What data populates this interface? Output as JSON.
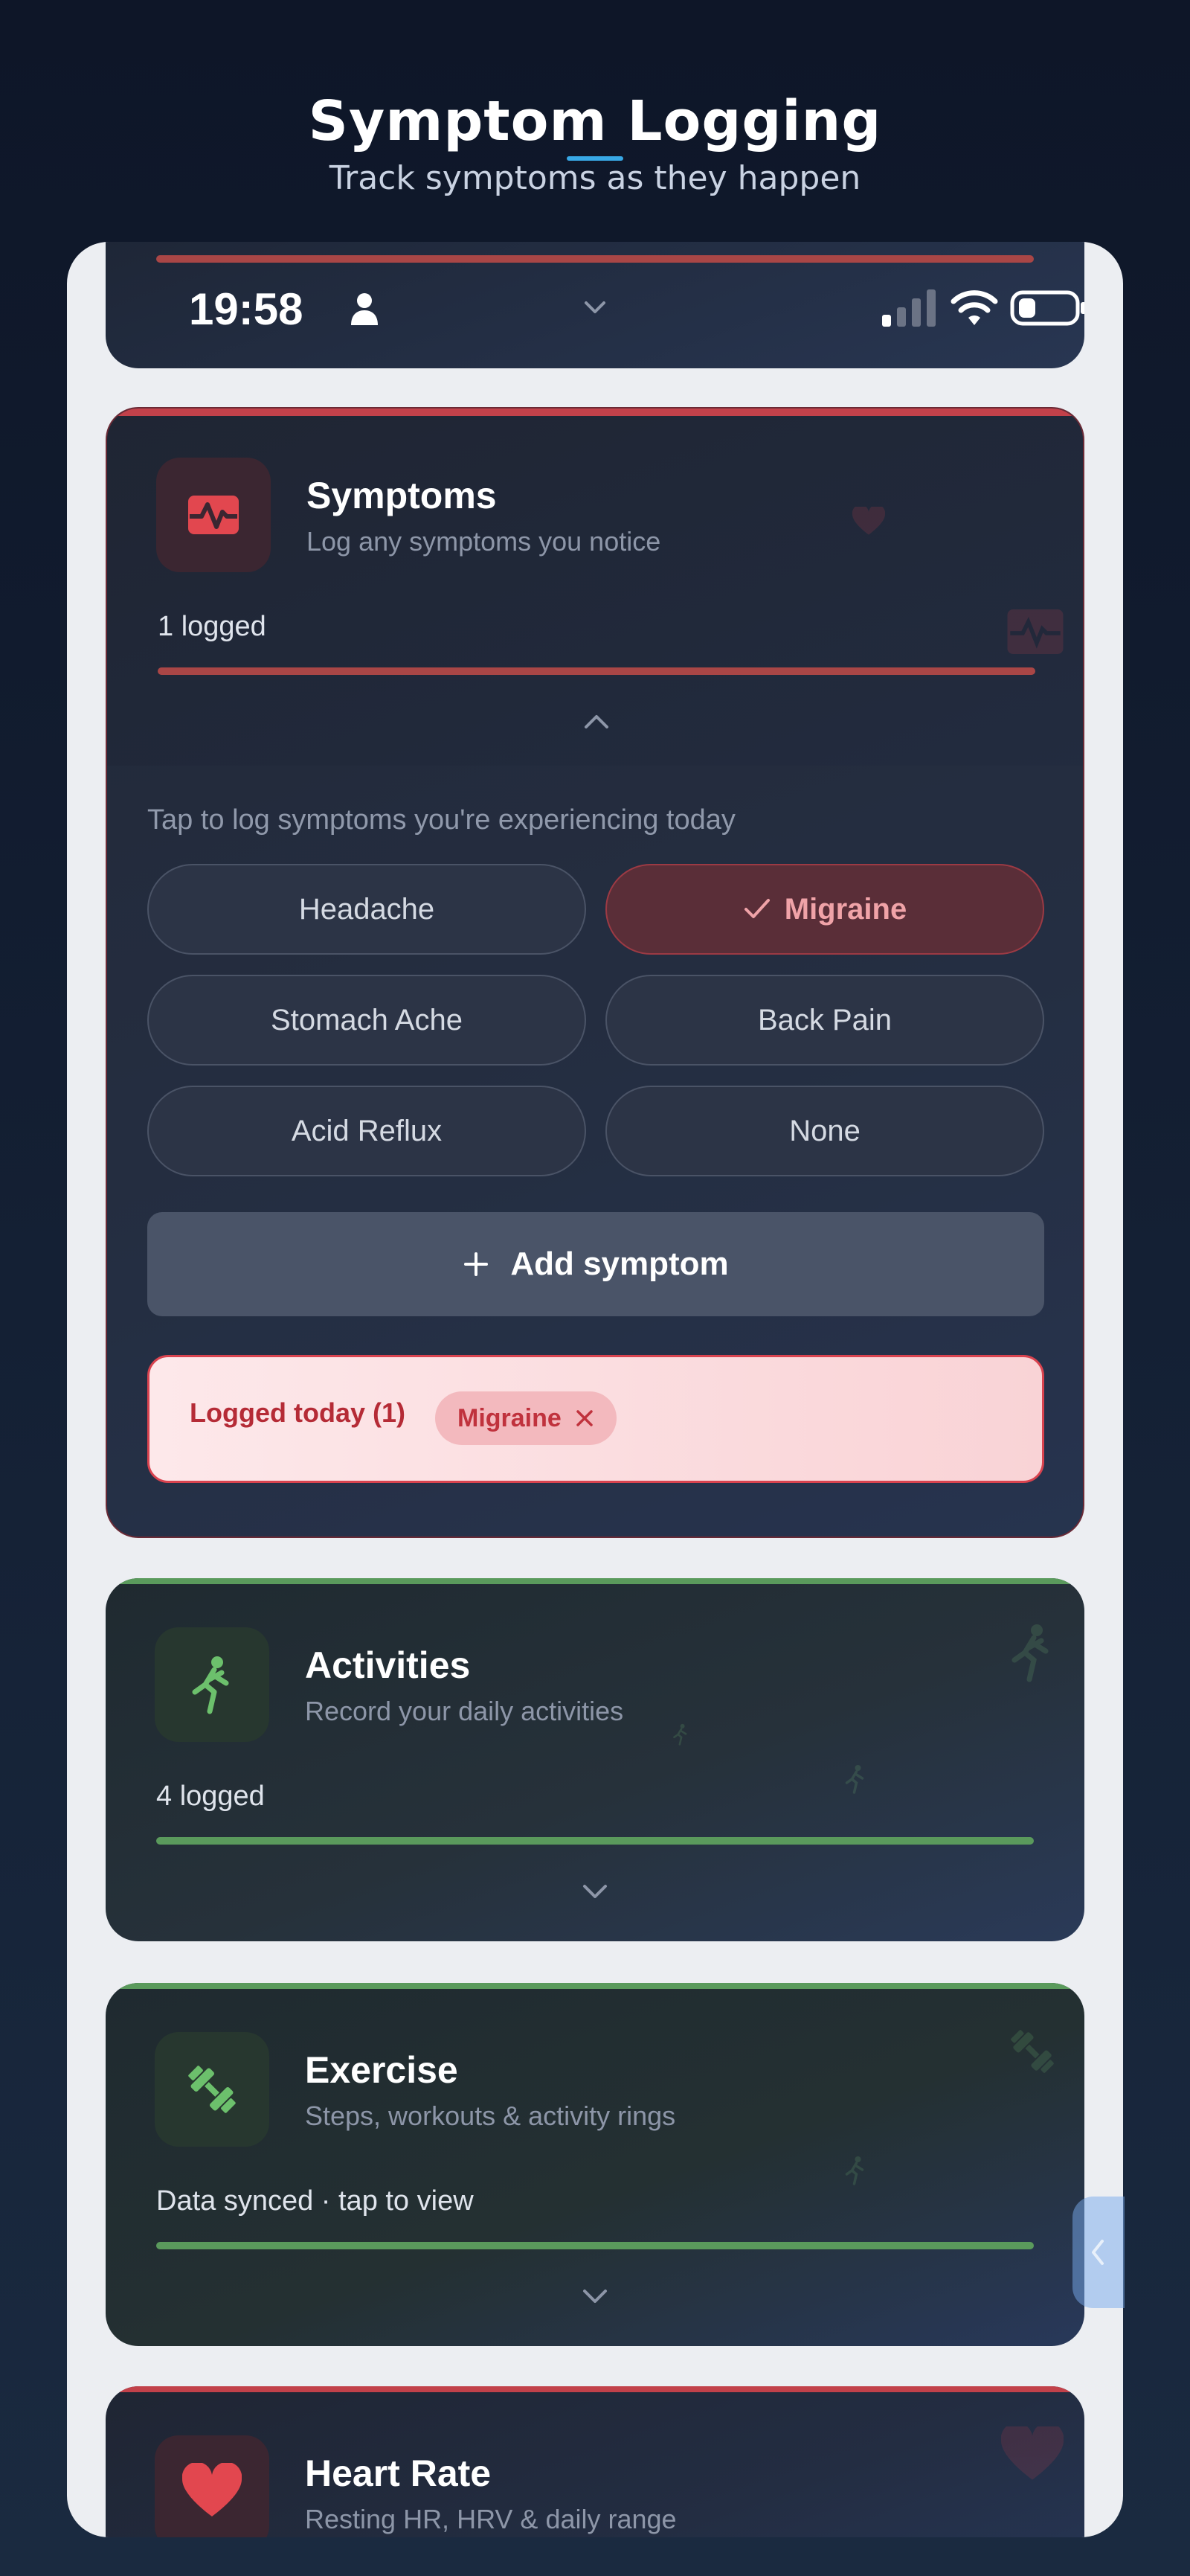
{
  "header": {
    "title": "Symptom Logging",
    "subtitle": "Track symptoms as they happen"
  },
  "status_bar": {
    "time": "19:58"
  },
  "symptoms": {
    "title": "Symptoms",
    "subtitle": "Log any symptoms you notice",
    "count": "1 logged",
    "hint": "Tap to log symptoms you're experiencing today",
    "options": [
      {
        "label": "Headache",
        "selected": false
      },
      {
        "label": "Migraine",
        "selected": true
      },
      {
        "label": "Stomach Ache",
        "selected": false
      },
      {
        "label": "Back Pain",
        "selected": false
      },
      {
        "label": "Acid Reflux",
        "selected": false
      },
      {
        "label": "None",
        "selected": false
      }
    ],
    "add_label": "Add symptom",
    "logged_label": "Logged today (1)",
    "logged_items": [
      "Migraine"
    ],
    "accent": "#d9434f"
  },
  "activities": {
    "title": "Activities",
    "subtitle": "Record your daily activities",
    "count": "4 logged",
    "accent": "#5a9a5c"
  },
  "exercise": {
    "title": "Exercise",
    "subtitle": "Steps, workouts & activity rings",
    "count": "Data synced · tap to view",
    "accent": "#5a9a5c"
  },
  "heart_rate": {
    "title": "Heart Rate",
    "subtitle": "Resting HR, HRV & daily range",
    "accent": "#d9434f"
  },
  "icons": {
    "symptoms": "heart-pulse-icon",
    "activities": "running-person-icon",
    "exercise": "dumbbell-icon",
    "heart_rate": "heart-icon"
  }
}
